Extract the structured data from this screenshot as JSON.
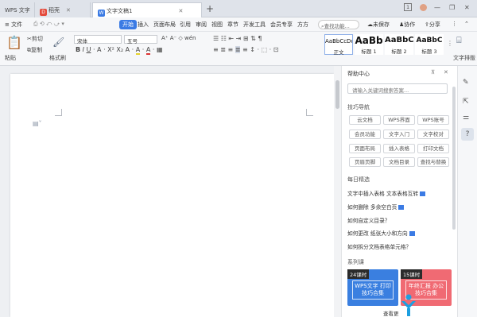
{
  "tabs": [
    {
      "label": "WPS 文字",
      "icon": "",
      "closable": false
    },
    {
      "label": "稻壳",
      "icon": "docer-icon",
      "closable": true
    },
    {
      "label": "文字文稿1",
      "icon": "wps-doc-icon",
      "closable": true
    }
  ],
  "window": {
    "page_indicator": "1",
    "new_tab": "+"
  },
  "menu": {
    "file": "≡ 文件",
    "items": [
      "开始",
      "插入",
      "页面布局",
      "引用",
      "审阅",
      "视图",
      "章节",
      "开发工具",
      "会员专享",
      "方方"
    ],
    "search": "查找功能...",
    "unsaved": "未保存",
    "collab": "协作",
    "share": "分享"
  },
  "ribbon": {
    "paste": "粘贴",
    "cut": "剪切",
    "copy": "复制",
    "format_painter": "格式刷",
    "font_name": "宋体",
    "font_size": "五号",
    "styles": [
      {
        "preview": "AaBbCcDd",
        "label": "正文"
      },
      {
        "preview": "AaBb",
        "label": "标题 1"
      },
      {
        "preview": "AaBbC",
        "label": "标题 2"
      },
      {
        "preview": "AaBbC",
        "label": "标题 3"
      }
    ],
    "text_tools": "文字排版"
  },
  "help": {
    "title": "帮助中心",
    "search_placeholder": "请输入关键词搜索答案...",
    "nav_title": "技巧导航",
    "chips": [
      "云文档",
      "WPS界面",
      "WPS账号",
      "会员功能",
      "文字入门",
      "文字校对",
      "页面布局",
      "插入表格",
      "打印文档",
      "页眉页脚",
      "文档目录",
      "查找与替换"
    ],
    "daily_title": "每日精选",
    "daily": [
      {
        "text": "文字中插入表格 文本表格互转",
        "video": true
      },
      {
        "text": "如何删除 多余空白页",
        "video": true
      },
      {
        "text": "如何自定义目录？",
        "video": false
      },
      {
        "text": "如何更改 纸张大小和方向",
        "video": true
      },
      {
        "text": "如何拆分文档表格单元格？",
        "video": false
      }
    ],
    "course_title": "系列课",
    "courses": [
      {
        "badge": "24课时",
        "title": "WPS文字 打印技巧合集",
        "color": "#3a7fe0"
      },
      {
        "badge": "15课时",
        "title": "年终汇报 办公技巧合集",
        "color": "#f06a73"
      }
    ],
    "more": "查看更"
  },
  "colors": {
    "accent": "#3b7be4",
    "tabbar": "#dfe3ea",
    "canvas": "#eef0f3"
  }
}
